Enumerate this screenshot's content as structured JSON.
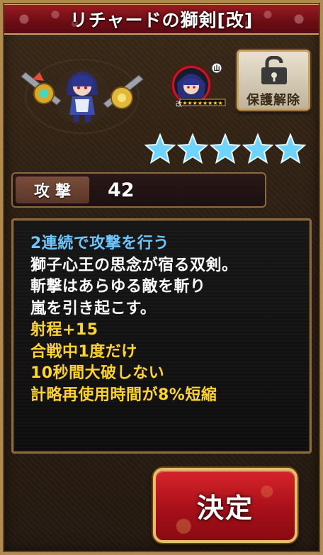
{
  "title": "リチャードの獅剣[改]",
  "unlock_button": {
    "label": "保護解除",
    "icon": "lock-icon"
  },
  "portrait": {
    "level_badge": "山",
    "tag": "改",
    "star_strip": "★★★★★★★★"
  },
  "rarity_stars": 5,
  "attack": {
    "label": "攻撃",
    "value": "42"
  },
  "description": {
    "lines": [
      {
        "text": "2連続で攻撃を行う",
        "color": "#6cc7ff"
      },
      {
        "text": "獅子心王の思念が宿る双剣。",
        "color": "#ffffff"
      },
      {
        "text": "斬撃はあらゆる敵を斬り",
        "color": "#ffffff"
      },
      {
        "text": "嵐を引き起こす。",
        "color": "#ffffff"
      },
      {
        "text": "射程+15",
        "color": "#ffd42a"
      },
      {
        "text": "合戦中1度だけ",
        "color": "#ffd42a"
      },
      {
        "text": "10秒間大破しない",
        "color": "#ffd42a"
      },
      {
        "text": "計略再使用時間が8%短縮",
        "color": "#ffd42a"
      }
    ]
  },
  "confirm_button": {
    "label": "決定"
  }
}
